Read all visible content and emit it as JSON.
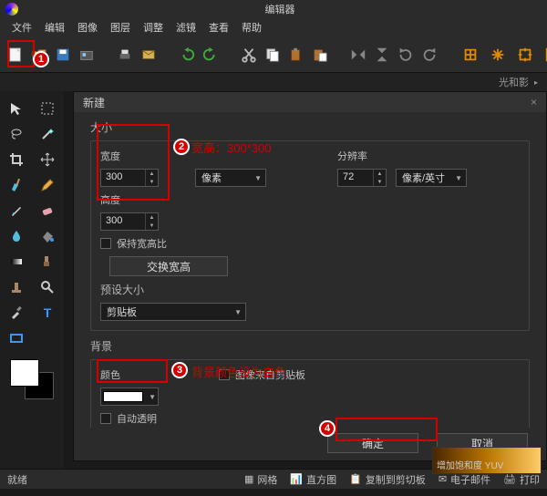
{
  "window": {
    "title": "编辑器",
    "tab": "新建",
    "right_tab": "光和影",
    "close": "×"
  },
  "menu": {
    "file": "文件",
    "edit": "编辑",
    "image": "图像",
    "layer": "图层",
    "adjust": "调整",
    "filter": "滤镜",
    "view": "查看",
    "help": "帮助"
  },
  "toolbar": {
    "new_tip": "new"
  },
  "dialog": {
    "title": "新建",
    "size_title": "大小",
    "width_label": "宽度",
    "width_value": "300",
    "height_label": "高度",
    "height_value": "300",
    "units": "像素",
    "res_label": "分辨率",
    "res_value": "72",
    "res_unit": "像素/英寸",
    "keep_ratio": "保持宽高比",
    "swap": "交换宽高",
    "preset_title": "预设大小",
    "preset_value": "剪贴板",
    "bg_title": "背景",
    "color_label": "颜色",
    "from_clip": "图像来自剪贴板",
    "auto_trans": "自动透明",
    "ok": "确定",
    "cancel": "取消"
  },
  "annot": {
    "n1": "1",
    "n2": "2",
    "n3": "3",
    "n4": "4",
    "note2": "宽高：300*300",
    "note3": "背景颜色设为白色"
  },
  "status": {
    "ready": "就绪",
    "grid": "网格",
    "histogram": "直方图",
    "copy": "复制到剪切板",
    "email": "电子邮件",
    "print": "打印"
  },
  "yuv": "增加饱和度 YUV"
}
